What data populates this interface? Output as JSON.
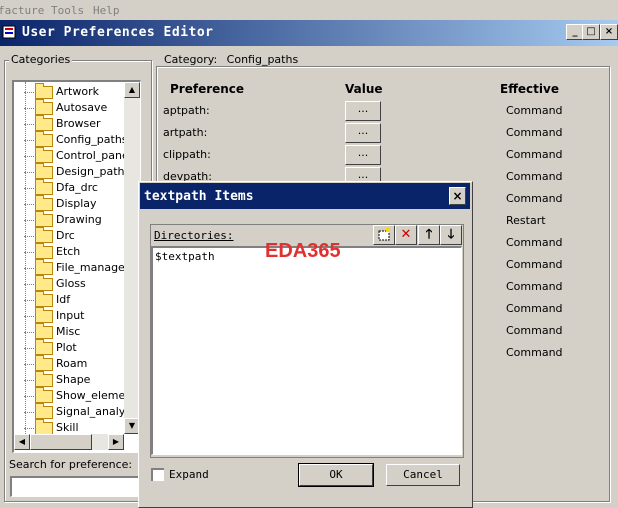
{
  "background_menu": [
    "facture",
    "Tools",
    "Help"
  ],
  "window": {
    "title": "User Preferences Editor",
    "minimize": "_",
    "maximize": "□",
    "close": "×"
  },
  "categories": {
    "label": "Categories",
    "items": [
      "Artwork",
      "Autosave",
      "Browser",
      "Config_paths",
      "Control_panel",
      "Design_paths",
      "Dfa_drc",
      "Display",
      "Drawing",
      "Drc",
      "Etch",
      "File_managem",
      "Gloss",
      "Idf",
      "Input",
      "Misc",
      "Plot",
      "Roam",
      "Shape",
      "Show_elemen",
      "Signal_analysi",
      "Skill"
    ]
  },
  "search": {
    "label": "Search for preference:",
    "value": ""
  },
  "category_panel": {
    "label": "Category:",
    "name": "Config_paths",
    "headers": {
      "preference": "Preference",
      "value": "Value",
      "effective": "Effective"
    },
    "rows": [
      {
        "name": "aptpath:",
        "button": "...",
        "effective": "Command"
      },
      {
        "name": "artpath:",
        "button": "...",
        "effective": "Command"
      },
      {
        "name": "clippath:",
        "button": "...",
        "effective": "Command"
      },
      {
        "name": "devpath:",
        "button": "...",
        "effective": "Command"
      }
    ],
    "effective_more": [
      "Command",
      "Restart",
      "Command",
      "Command",
      "Command",
      "Command",
      "Command",
      "Command"
    ]
  },
  "dialog": {
    "title": "textpath Items",
    "close": "×",
    "directories_label": "Directories:",
    "items": [
      "$textpath"
    ],
    "expand_label": "Expand",
    "expand_checked": false,
    "ok_label": "OK",
    "cancel_label": "Cancel"
  },
  "watermark": "EDA365",
  "colors": {
    "titlebar": "#0a246a",
    "watermark": "#e03030",
    "face": "#d4d0c8"
  }
}
